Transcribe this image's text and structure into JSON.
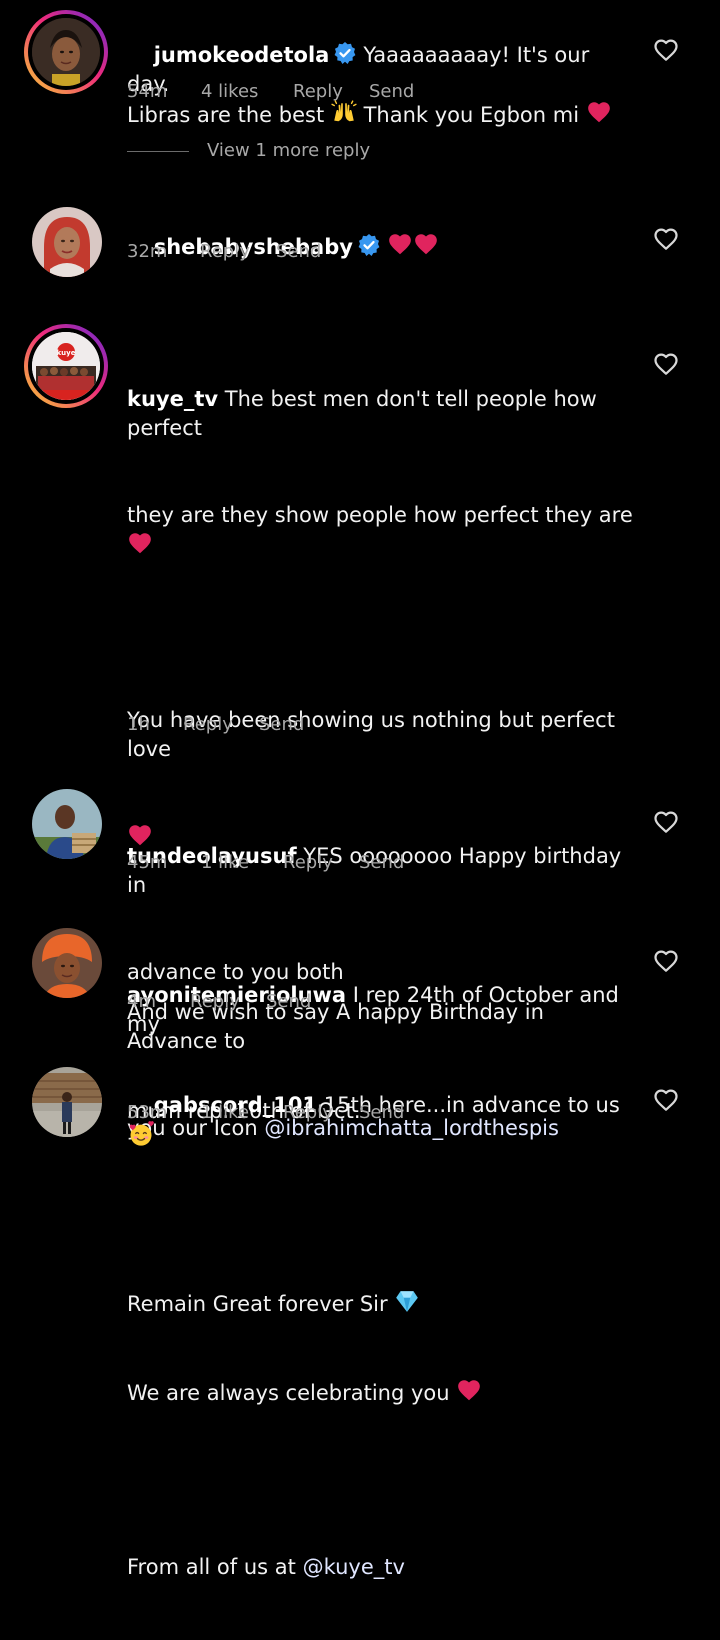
{
  "comments": [
    {
      "username": "jumokeodetola",
      "verified": true,
      "text_lines": [
        "Yaaaaaaaaay! It's our day.",
        "Libras are the best",
        "Thank you Egbon mi"
      ],
      "time": "54m",
      "likes": "4 likes",
      "reply": "Reply",
      "send": "Send",
      "view_more": "View 1 more reply"
    },
    {
      "username": "shebabyshebaby",
      "verified": true,
      "time": "32m",
      "reply": "Reply",
      "send": "Send"
    },
    {
      "username": "kuye_tv",
      "verified": false,
      "line1": "The best men don't tell people how perfect",
      "line2": "they are they show people how perfect they are",
      "para2": "You have been showing us nothing but perfect love",
      "para3a": "And we wish to say A happy Birthday in Advance to",
      "para3b": "you our Icon",
      "mention1": "@ibrahimchatta_lordthespis",
      "para4a": "Remain Great forever Sir",
      "para4b": "We are always celebrating you",
      "para5": "From all of us at",
      "mention2": "@kuye_tv",
      "time": "1h",
      "reply": "Reply",
      "send": "Send"
    },
    {
      "username": "tundeolayusuf",
      "text": "YES oooooooo Happy birthday in",
      "text2": "advance to you both",
      "time": "45m",
      "likes": "1 like",
      "reply": "Reply",
      "send": "Send"
    },
    {
      "username": "ayonitemierioluwa",
      "text": "I rep 24th of October and my",
      "text2": "mum rep. 10th of Oct.",
      "time": "4m",
      "reply": "Reply",
      "send": "Send"
    },
    {
      "username": "gabscord_101",
      "text": "15th here...in advance to us",
      "time": "53m",
      "likes": "1 like",
      "reply": "Reply",
      "send": "Send"
    }
  ],
  "kuye_logo_text": "kuye",
  "colors": {
    "background": "#000000",
    "verified": "#3897f0",
    "heart_emoji": "#e0245e",
    "meta": "#a8a8a8"
  }
}
